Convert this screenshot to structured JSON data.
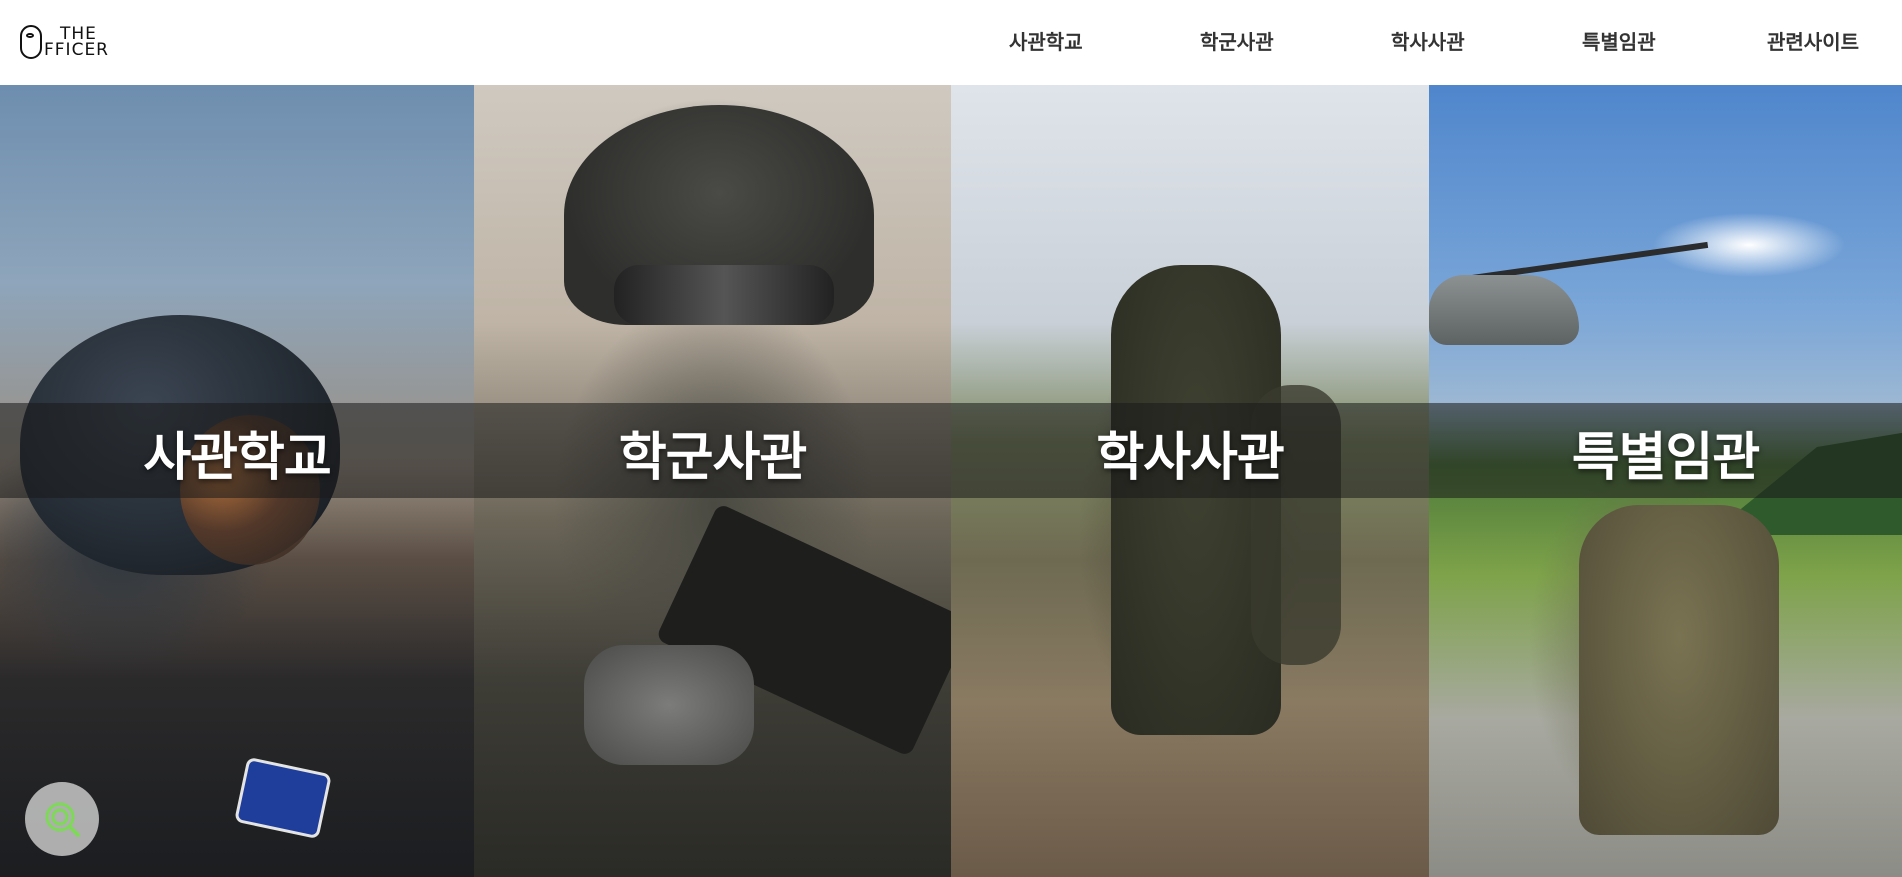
{
  "header": {
    "logo": {
      "line1": "THE",
      "line2": "FFICER"
    },
    "nav": [
      {
        "label": "사관학교"
      },
      {
        "label": "학군사관"
      },
      {
        "label": "학사사관"
      },
      {
        "label": "특별임관"
      },
      {
        "label": "관련사이트"
      }
    ]
  },
  "panels": [
    {
      "title": "사관학교"
    },
    {
      "title": "학군사관"
    },
    {
      "title": "학사사관"
    },
    {
      "title": "특별임관"
    }
  ],
  "fab": {
    "icon": "search-icon"
  },
  "colors": {
    "nav_text": "#333333",
    "band": "rgba(25,25,25,0.55)",
    "fab_icon": "#7ed957"
  }
}
